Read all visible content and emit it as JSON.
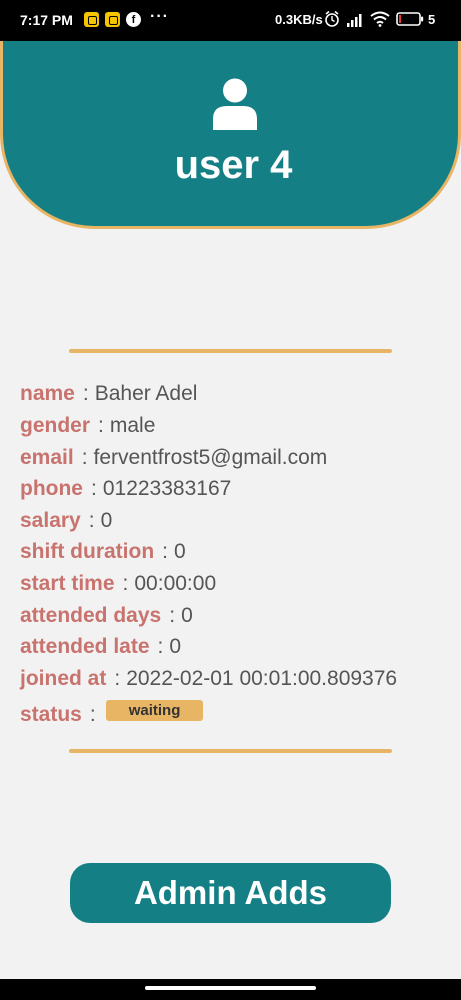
{
  "status_bar": {
    "time": "7:17 PM",
    "dots": "···",
    "speed": "0.3KB/s",
    "battery": "5"
  },
  "header": {
    "title": "user 4",
    "icon": "user-icon"
  },
  "details": [
    {
      "label": "name",
      "value": "Baher Adel"
    },
    {
      "label": "gender",
      "value": "male"
    },
    {
      "label": "email",
      "value": "ferventfrost5@gmail.com"
    },
    {
      "label": "phone",
      "value": "01223383167"
    },
    {
      "label": "salary",
      "value": "0"
    },
    {
      "label": "shift duration",
      "value": "0"
    },
    {
      "label": "start time",
      "value": "00:00:00"
    },
    {
      "label": "attended days",
      "value": "0"
    },
    {
      "label": "attended late",
      "value": "0"
    },
    {
      "label": "joined at",
      "value": "2022-02-01 00:01:00.809376"
    }
  ],
  "status": {
    "label": "status",
    "value": "waiting"
  },
  "admin_button": {
    "label": "Admin Adds"
  },
  "colors": {
    "teal": "#148085",
    "gold": "#e8b565",
    "label": "#c8736e"
  }
}
